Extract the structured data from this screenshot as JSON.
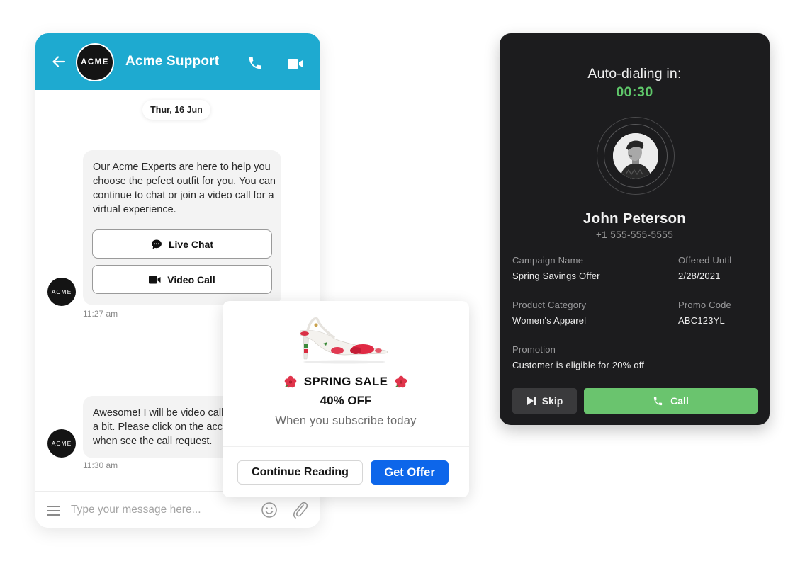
{
  "chat": {
    "header": {
      "title": "Acme Support",
      "avatar_text": "ACME",
      "back_icon": "arrow-left-icon",
      "phone_icon": "phone-icon",
      "video_icon": "video-camera-icon",
      "color": "#1eaad0"
    },
    "date_separator": "Thur, 16 Jun",
    "messages": [
      {
        "sender_avatar": "ACME",
        "text": "Our Acme Experts are here to help you choose the pefect outfit for you. You can continue to chat or join a video call for a virtual experience.",
        "options": [
          {
            "label": "Live Chat",
            "icon": "chat-bubble-icon"
          },
          {
            "label": "Video Call",
            "icon": "video-camera-icon"
          }
        ],
        "time": "11:27 am"
      },
      {
        "sender_avatar": "ACME",
        "text": "Awesome! I will be video calling you in a bit. Please click on the accept button when see the call request.",
        "time": "11:30 am"
      }
    ],
    "composer": {
      "placeholder": "Type your message here...",
      "value": "",
      "menu_icon": "hamburger-menu-icon",
      "emoji_icon": "smiley-icon",
      "attach_icon": "paperclip-icon"
    }
  },
  "promo": {
    "image": "red-floral-slingback-heel",
    "title": "SPRING SALE",
    "title_icon": "hibiscus-flower-icon",
    "discount": "40% OFF",
    "subtitle": "When you subscribe today",
    "secondary_button": "Continue Reading",
    "primary_button": "Get Offer",
    "primary_color": "#0d66ea"
  },
  "dialer": {
    "label": "Auto-dialing in:",
    "countdown": "00:30",
    "countdown_color": "#5fc76a",
    "caller": {
      "name": "John Peterson",
      "phone": "+1 555-555-5555",
      "photo": "caller-portrait"
    },
    "fields": [
      {
        "label": "Campaign Name",
        "value": "Spring Savings Offer"
      },
      {
        "label": "Offered Until",
        "value": "2/28/2021"
      },
      {
        "label": "Product Category",
        "value": "Women's Apparel"
      },
      {
        "label": "Promo Code",
        "value": "ABC123YL"
      },
      {
        "label": "Promotion",
        "value": "Customer is eligible for 20% off"
      }
    ],
    "skip_button": "Skip",
    "skip_icon": "skip-forward-icon",
    "call_button": "Call",
    "call_icon": "phone-icon",
    "call_color": "#6ac46e"
  }
}
